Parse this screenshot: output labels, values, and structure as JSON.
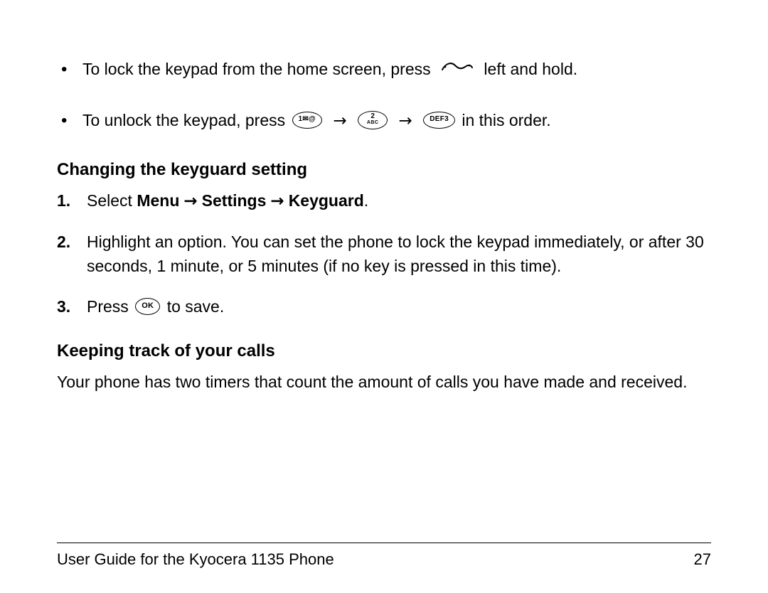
{
  "bullets": [
    {
      "pre": "To lock the keypad from the home screen, press ",
      "post": " left and hold."
    },
    {
      "pre": "To unlock the keypad, press ",
      "mid": " in this order."
    }
  ],
  "arrow": "→",
  "keys": {
    "one": "1✉@",
    "two_top": "2",
    "two_bot": "ABC",
    "three": "DEF3",
    "ok": "OK"
  },
  "section1": {
    "heading": "Changing the keyguard setting",
    "steps": [
      {
        "num": "1.",
        "text_prefix": "Select ",
        "bold1": "Menu",
        "bold2": "Settings",
        "bold3": "Keyguard",
        "text_suffix": "."
      },
      {
        "num": "2.",
        "text": "Highlight an option. You can set the phone to lock the keypad immediately, or after 30 seconds, 1 minute, or 5 minutes (if no key is pressed in this time)."
      },
      {
        "num": "3.",
        "text_prefix": "Press ",
        "text_suffix": " to save."
      }
    ]
  },
  "section2": {
    "heading": "Keeping track of your calls",
    "paragraph": "Your phone has two timers that count the amount of calls you have made and received."
  },
  "footer": {
    "title": "User Guide for the Kyocera 1135 Phone",
    "page": "27"
  }
}
